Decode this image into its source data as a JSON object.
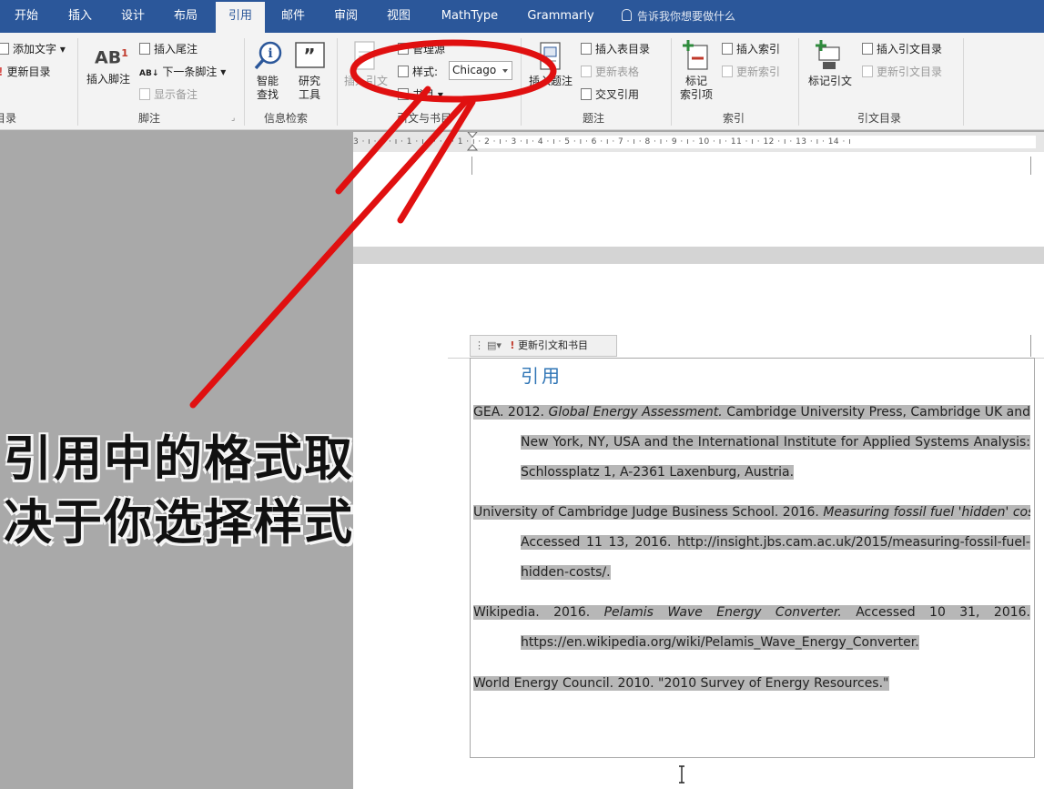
{
  "tabs": [
    "开始",
    "插入",
    "设计",
    "布局",
    "引用",
    "邮件",
    "审阅",
    "视图",
    "MathType",
    "Grammarly"
  ],
  "active_tab": "引用",
  "tell_me": "告诉我你想要做什么",
  "ribbon": {
    "toc": {
      "add_text": "添加文字",
      "update_toc": "更新目录",
      "label": "目录"
    },
    "footnotes": {
      "insert_footnote": "插入脚注",
      "insert_endnote": "插入尾注",
      "next_footnote": "下一条脚注",
      "show_notes": "显示备注",
      "label": "脚注",
      "ab_glyph": "AB"
    },
    "research": {
      "smart_lookup": "智能\n查找",
      "researcher": "研究\n工具",
      "label": "信息检索"
    },
    "citations": {
      "insert_citation": "插入引文",
      "manage_sources": "管理源",
      "style_label": "样式:",
      "style_value": "Chicago",
      "bibliography": "书目",
      "label": "引文与书目"
    },
    "captions": {
      "insert_caption": "插入题注",
      "insert_tof": "插入表目录",
      "update_table": "更新表格",
      "cross_ref": "交叉引用",
      "label": "题注"
    },
    "index": {
      "mark_entry": "标记\n索引项",
      "insert_index": "插入索引",
      "update_index": "更新索引",
      "label": "索引"
    },
    "toa": {
      "mark_citation": "标记引文",
      "insert_toa": "插入引文目录",
      "update_toa": "更新引文目录",
      "label": "引文目录"
    }
  },
  "ruler_text": "3 · ı · 2 · ı · 1 · ı · · · ı · 1 · ı · 2 · ı · 3 · ı · 4 · ı · 5 · ı · 6 · ı · 7 · ı · 8 · ı · 9 · ı · 10 · ı · 11 · ı · 12 · ı · 13 · ı · 14 · ı",
  "content_control": {
    "update_label": "更新引文和书目"
  },
  "bibliography": {
    "title": "引用",
    "entries": [
      {
        "lines": [
          {
            "pre": "GEA. 2012. ",
            "em": "Global Energy Assessment.",
            "post": " Cambridge University Press, Cambridge UK and"
          },
          {
            "pre": "New York, NY, USA and the International Institute for Applied Systems Analysis:",
            "em": "",
            "post": ""
          },
          {
            "pre": "Schlossplatz 1, A-2361 Laxenburg, Austria.",
            "em": "",
            "post": ""
          }
        ]
      },
      {
        "lines": [
          {
            "pre": "University of Cambridge Judge Business School. 2016. ",
            "em": "Measuring fossil fuel 'hidden' costs.",
            "post": ""
          },
          {
            "pre": "Accessed 11 13, 2016. http://insight.jbs.cam.ac.uk/2015/measuring-fossil-fuel-",
            "em": "",
            "post": ""
          },
          {
            "pre": "hidden-costs/.",
            "em": "",
            "post": ""
          }
        ]
      },
      {
        "lines": [
          {
            "pre": "Wikipedia. 2016. ",
            "em": "Pelamis Wave Energy Converter.",
            "post": " Accessed 10 31, 2016."
          },
          {
            "pre": "https://en.wikipedia.org/wiki/Pelamis_Wave_Energy_Converter.",
            "em": "",
            "post": ""
          }
        ]
      },
      {
        "lines": [
          {
            "pre": "World Energy Council. 2010. \"2010 Survey of Energy Resources.\"",
            "em": "",
            "post": ""
          }
        ]
      }
    ]
  },
  "caption": {
    "line1": "引用中的格式取",
    "line2": "决于你选择样式"
  },
  "colors": {
    "ribbon_blue": "#2b579a",
    "annotation_red": "#e01010",
    "heading_blue": "#2e74b5",
    "highlight_gray": "#b7b7b7"
  }
}
